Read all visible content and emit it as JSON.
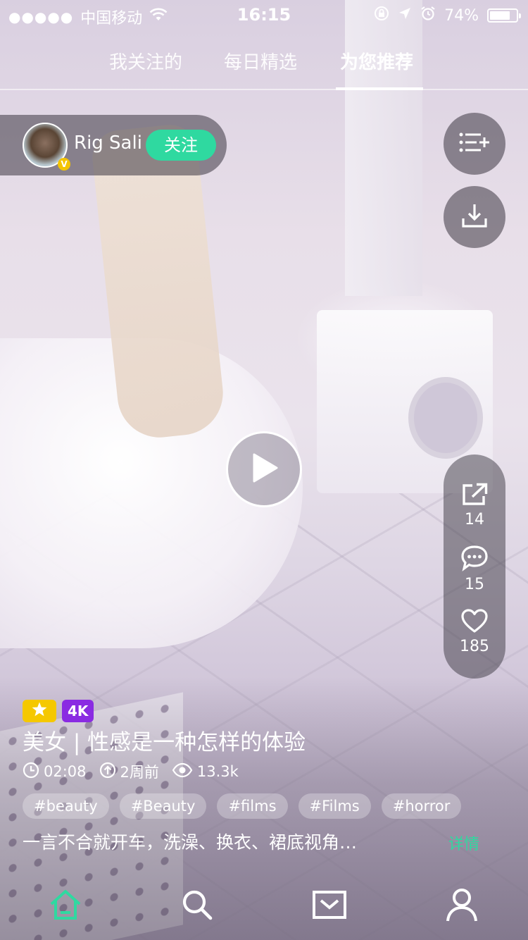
{
  "status_bar": {
    "signal": "●●●●●",
    "carrier": "中国移动",
    "time": "16:15",
    "battery": "74%"
  },
  "tabs": [
    {
      "label": "我关注的"
    },
    {
      "label": "每日精选"
    },
    {
      "label": "为您推荐",
      "active": true
    }
  ],
  "author": {
    "name": "Rig Sali",
    "badge": "V",
    "follow_label": "关注"
  },
  "actions": {
    "share_count": "14",
    "comment_count": "15",
    "like_count": "185"
  },
  "video": {
    "badge_4k": "4K",
    "title": "美女 | 性感是一种怎样的体验",
    "duration": "02:08",
    "uploaded": "2周前",
    "views": "13.3k",
    "tags": [
      "#beauty",
      "#Beauty",
      "#films",
      "#Films",
      "#horror"
    ],
    "description": "一言不合就开车，洗澡、换衣、裙底视角…",
    "more_label": "详情"
  },
  "colors": {
    "accent": "#2fd9a0",
    "star_badge": "#f5c800",
    "badge_4k": "#8a2be2"
  },
  "nav_icons": [
    "home-icon",
    "search-icon",
    "inbox-icon",
    "profile-icon"
  ]
}
